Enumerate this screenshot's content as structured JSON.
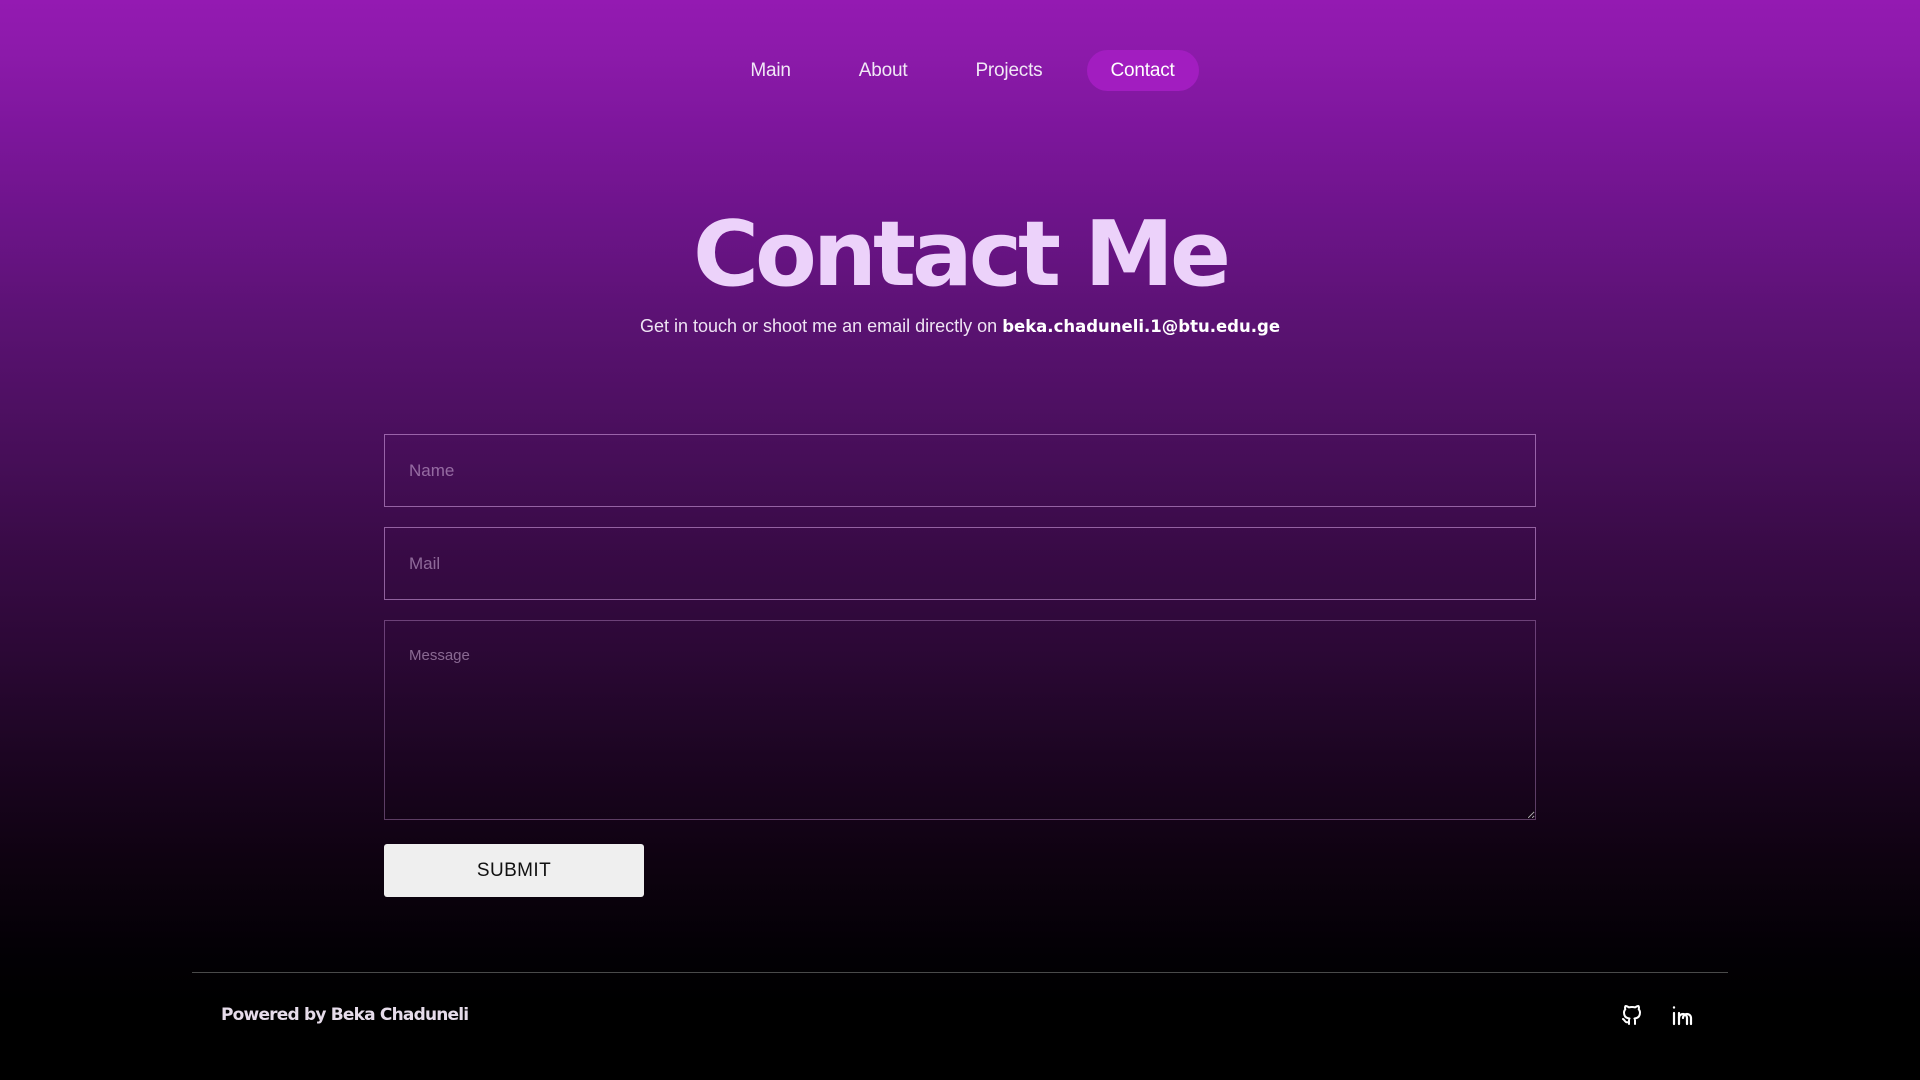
{
  "nav": {
    "items": [
      {
        "label": "Main",
        "active": false
      },
      {
        "label": "About",
        "active": false
      },
      {
        "label": "Projects",
        "active": false
      },
      {
        "label": "Contact",
        "active": true
      }
    ]
  },
  "hero": {
    "title": "Contact Me",
    "subtitle": "Get in touch or shoot me an email directly on",
    "email": "beka.chaduneli.1@btu.edu.ge"
  },
  "form": {
    "name_placeholder": "Name",
    "mail_placeholder": "Mail",
    "message_placeholder": "Message",
    "submit_label": "SUBMIT"
  },
  "footer": {
    "credit": "Powered by Beka Chaduneli",
    "icons": [
      "github-icon",
      "linkedin-icon"
    ]
  },
  "colors": {
    "gradient_top": "#941ab2",
    "gradient_bottom": "#000000",
    "nav_active_bg": "#a21dc0",
    "title_color": "#ecd2fa",
    "submit_bg": "#efefef"
  }
}
